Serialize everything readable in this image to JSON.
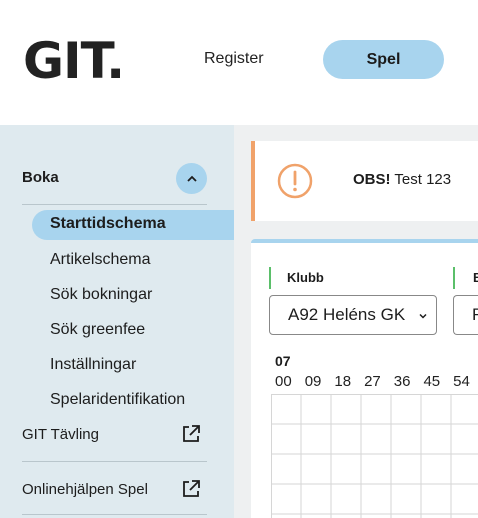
{
  "header": {
    "logo": "GIT.",
    "nav": [
      {
        "label": "Register"
      },
      {
        "label": "Spel",
        "active": true
      }
    ]
  },
  "sidebar": {
    "section_title": "Boka",
    "sub_items": [
      {
        "label": "Starttidschema",
        "active": true
      },
      {
        "label": "Artikelschema"
      },
      {
        "label": "Sök bokningar"
      },
      {
        "label": "Sök greenfee"
      },
      {
        "label": "Inställningar"
      },
      {
        "label": "Spelaridentifikation"
      }
    ],
    "links": [
      {
        "label": "GIT Tävling",
        "icon": "external-link-icon"
      },
      {
        "label": "Onlinehjälpen Spel",
        "icon": "external-link-icon"
      }
    ]
  },
  "notice": {
    "bold": "OBS!",
    "text": " Test 123",
    "icon": "warning-circle-icon",
    "accent_color": "#f0a26a"
  },
  "filters": {
    "klubb_label": "Klubb",
    "klubb_value": "A92 Heléns GK",
    "second_label": "B",
    "second_value": "F"
  },
  "schedule": {
    "hour": "07",
    "minutes": [
      "00",
      "09",
      "18",
      "27",
      "36",
      "45",
      "54"
    ]
  },
  "colors": {
    "accent": "#a8d4ee",
    "sidebar_bg": "#dfeaef",
    "main_bg": "#eef0f1",
    "status_green": "#5bbf6a"
  }
}
